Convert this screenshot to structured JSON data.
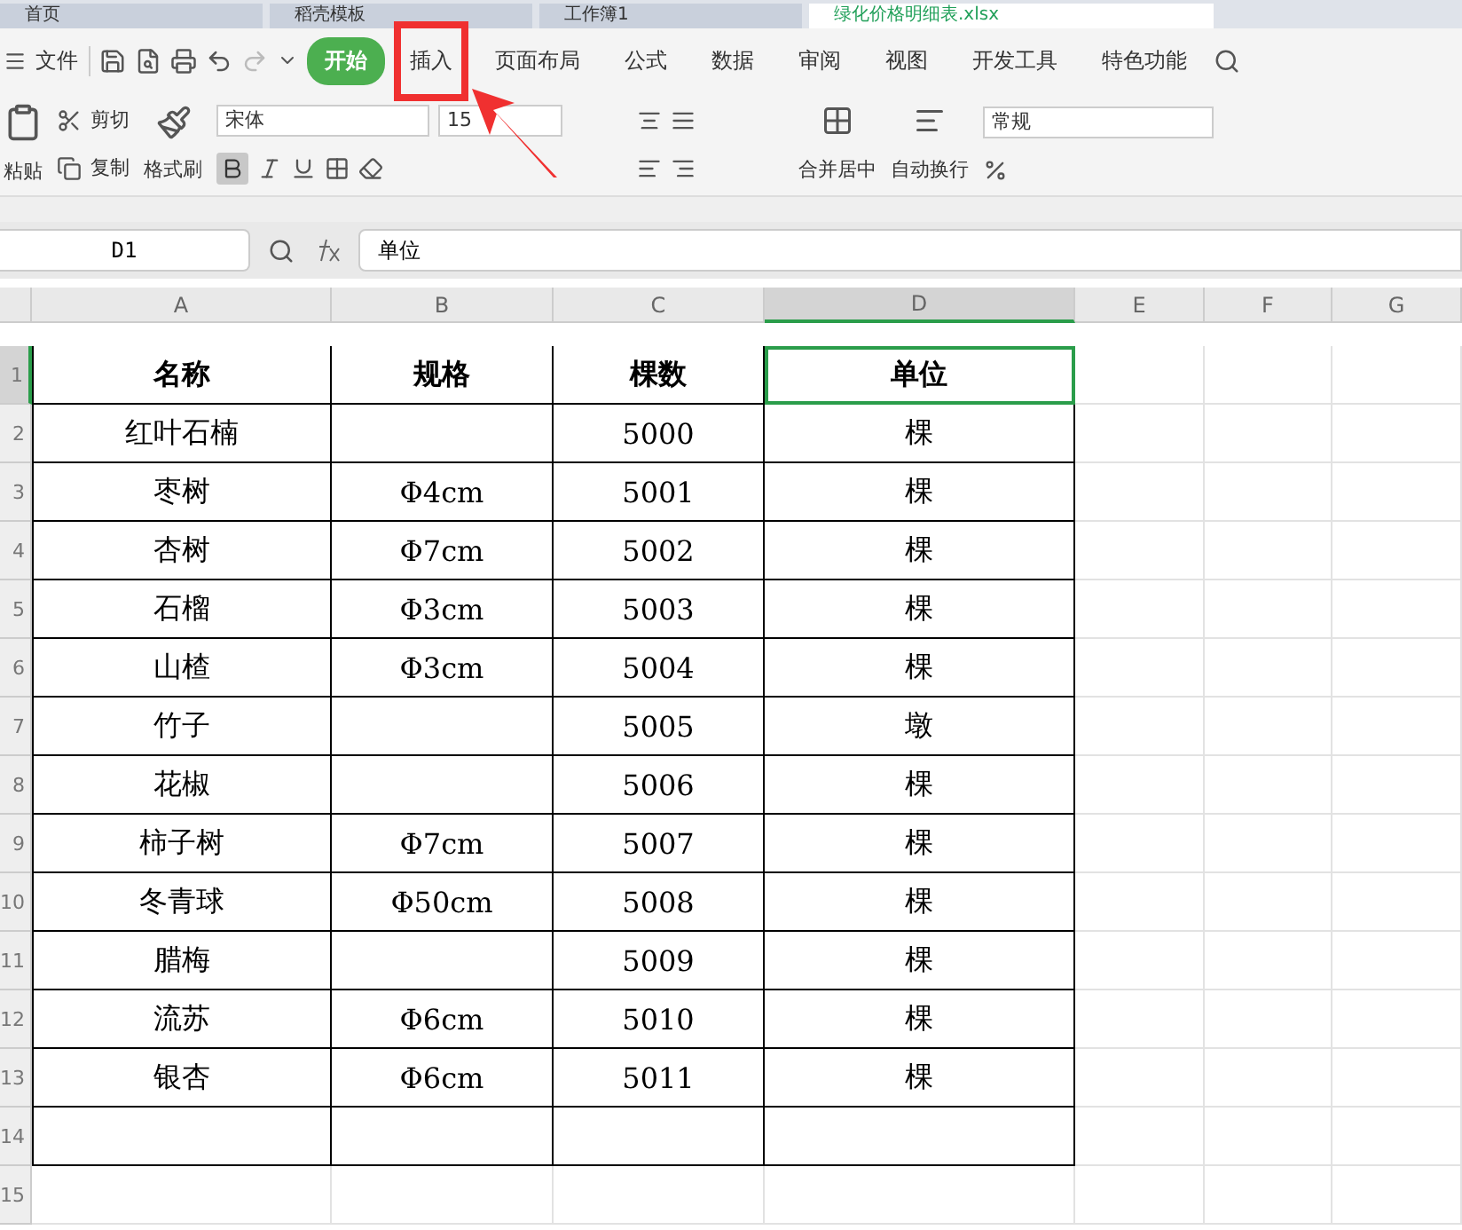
{
  "doc_tabs": [
    {
      "label": "首页",
      "selected": false
    },
    {
      "label": "稻壳模板",
      "selected": false
    },
    {
      "label": "工作簿1",
      "selected": false
    },
    {
      "label": "绿化价格明细表.xlsx",
      "selected": true
    }
  ],
  "menu": {
    "file": "文件",
    "tabs": [
      {
        "label": "开始",
        "selected": true
      },
      {
        "label": "插入",
        "selected": false,
        "highlighted": true
      },
      {
        "label": "页面布局",
        "selected": false,
        "highlighted": false
      },
      {
        "label": "公式",
        "selected": false,
        "highlighted": false
      },
      {
        "label": "数据",
        "selected": false,
        "highlighted": false
      },
      {
        "label": "审阅",
        "selected": false,
        "highlighted": false
      },
      {
        "label": "视图",
        "selected": false,
        "highlighted": false
      },
      {
        "label": "开发工具",
        "selected": false,
        "highlighted": false
      },
      {
        "label": "特色功能",
        "selected": false,
        "highlighted": false
      }
    ]
  },
  "ribbon": {
    "paste": "粘贴",
    "cut": "剪切",
    "copy": "复制",
    "format_painter": "格式刷",
    "font": "宋体",
    "font_size": "15",
    "bold": true,
    "merge": "合并居中",
    "wrap": "自动换行",
    "number_format": "常规"
  },
  "formula_bar": {
    "cell": "D1",
    "value": "单位"
  },
  "table": {
    "columns": [
      {
        "label": "A",
        "selected": false
      },
      {
        "label": "B",
        "selected": false
      },
      {
        "label": "C",
        "selected": false
      },
      {
        "label": "D",
        "selected": true
      },
      {
        "label": "E",
        "selected": false
      },
      {
        "label": "F",
        "selected": false
      },
      {
        "label": "G",
        "selected": false
      }
    ],
    "header": [
      "名称",
      "规格",
      "棵数",
      "单位"
    ],
    "rows": [
      {
        "name": "红叶石楠",
        "count": "5000",
        "unit": "棵"
      },
      {
        "name": "枣树",
        "spec": "Φ4cm",
        "count": "5001",
        "unit": "棵"
      },
      {
        "name": "杏树",
        "spec": "Φ7cm",
        "count": "5002",
        "unit": "棵"
      },
      {
        "name": "石榴",
        "spec": "Φ3cm",
        "count": "5003",
        "unit": "棵"
      },
      {
        "name": "山楂",
        "spec": "Φ3cm",
        "count": "5004",
        "unit": "棵"
      },
      {
        "name": "竹子",
        "count": "5005",
        "unit": "墩"
      },
      {
        "name": "花椒",
        "count": "5006",
        "unit": "棵"
      },
      {
        "name": "柿子树",
        "spec": "Φ7cm",
        "count": "5007",
        "unit": "棵"
      },
      {
        "name": "冬青球",
        "spec": "Φ50cm",
        "count": "5008",
        "unit": "棵"
      },
      {
        "name": "腊梅",
        "count": "5009",
        "unit": "棵"
      },
      {
        "name": "流苏",
        "spec": "Φ6cm",
        "count": "5010",
        "unit": "棵"
      },
      {
        "name": "银杏",
        "spec": "Φ6cm",
        "count": "5011",
        "unit": "棵"
      }
    ],
    "row_numbers": [
      {
        "label": "1",
        "selected": true
      },
      {
        "label": "2",
        "selected": false
      },
      {
        "label": "3",
        "selected": false
      },
      {
        "label": "4",
        "selected": false
      },
      {
        "label": "5",
        "selected": false
      },
      {
        "label": "6",
        "selected": false
      },
      {
        "label": "7",
        "selected": false
      },
      {
        "label": "8",
        "selected": false
      },
      {
        "label": "9",
        "selected": false
      },
      {
        "label": "10",
        "selected": false
      },
      {
        "label": "11",
        "selected": false
      },
      {
        "label": "12",
        "selected": false
      },
      {
        "label": "13",
        "selected": false
      },
      {
        "label": "14",
        "selected": false
      },
      {
        "label": "15",
        "selected": false
      }
    ]
  }
}
